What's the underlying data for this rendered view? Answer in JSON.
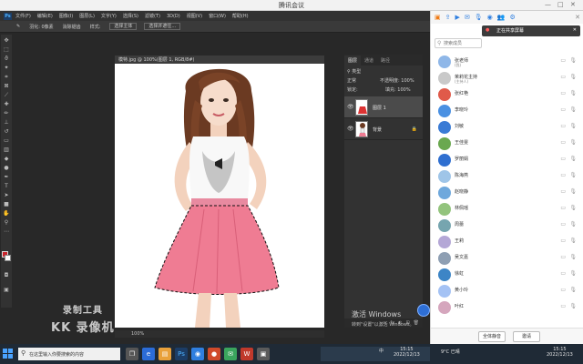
{
  "meeting": {
    "title": "腾讯会议"
  },
  "ps": {
    "menu": [
      "文件(F)",
      "编辑(E)",
      "图像(I)",
      "图层(L)",
      "文字(Y)",
      "选择(S)",
      "滤镜(T)",
      "3D(D)",
      "视图(V)",
      "窗口(W)",
      "帮助(H)"
    ],
    "options": {
      "feather": "羽化: 0像素",
      "antialias": "消除锯齿",
      "style": "样式:",
      "select_subject": "选择主体",
      "select_mask": "选择并遮住..."
    },
    "doc_tab": "模特.jpg @ 100%(图层 1, RGB/8#)",
    "doc_status": "100%",
    "panels": {
      "tabs": [
        "图层",
        "通道",
        "路径"
      ],
      "kind": "类型",
      "blend_mode": "正常",
      "opacity": "不透明度: 100%",
      "fill": "填充: 100%",
      "lock": "锁定:",
      "layers": [
        {
          "name": "图层 1",
          "selected": true
        },
        {
          "name": "背景",
          "selected": false
        }
      ]
    },
    "activate": {
      "line1": "激活 Windows",
      "line2": "转到\"设置\"以激活 Windows。"
    }
  },
  "watermark": {
    "line1": "录制工具",
    "line2": "KK 录像机"
  },
  "side": {
    "sharing": "正在共享屏幕",
    "search_placeholder": "搜索成员",
    "members": [
      {
        "name": "张老师",
        "sub": "(我)",
        "color": "#8fb7e8"
      },
      {
        "name": "茉莉花主持",
        "sub": "(主持人)",
        "color": "#c9c9c9"
      },
      {
        "name": "张红艳",
        "sub": "",
        "color": "#e05a4a"
      },
      {
        "name": "李晓玲",
        "sub": "",
        "color": "#4a90e2"
      },
      {
        "name": "刘敏",
        "sub": "",
        "color": "#3a7bd5"
      },
      {
        "name": "王佳雯",
        "sub": "",
        "color": "#6aa84f"
      },
      {
        "name": "罗丽娟",
        "sub": "",
        "color": "#2f6fd0"
      },
      {
        "name": "陈海燕",
        "sub": "",
        "color": "#9fc5e8"
      },
      {
        "name": "赵晓静",
        "sub": "",
        "color": "#6fa8dc"
      },
      {
        "name": "林佩瑶",
        "sub": "",
        "color": "#93c47d"
      },
      {
        "name": "周蕾",
        "sub": "",
        "color": "#76a5af"
      },
      {
        "name": "王莉",
        "sub": "",
        "color": "#b4a7d6"
      },
      {
        "name": "吴文嘉",
        "sub": "",
        "color": "#8e9fb3"
      },
      {
        "name": "徐虹",
        "sub": "",
        "color": "#3d85c6"
      },
      {
        "name": "黄小玲",
        "sub": "",
        "color": "#a4c2f4"
      },
      {
        "name": "叶红",
        "sub": "",
        "color": "#d5a6bd"
      }
    ],
    "buttons": {
      "mute_all": "全体静音",
      "invite": "邀请"
    }
  },
  "taskbar": {
    "search": "在这里输入你要搜索的内容",
    "tray_lang": "中",
    "tray_time_1": "15:15",
    "tray_date_1": "2022/12/13",
    "tray_time_2": "15:15",
    "tray_date_2": "2022/12/13",
    "weather": "9°C 已晴"
  }
}
